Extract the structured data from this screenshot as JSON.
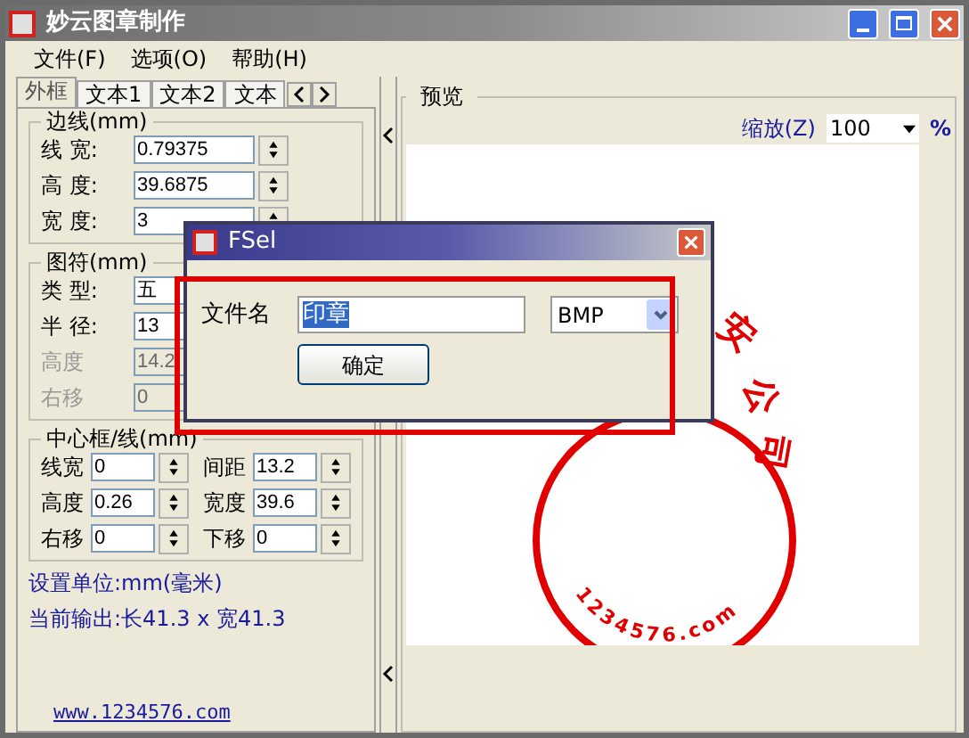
{
  "window": {
    "title": "妙云图章制作"
  },
  "menu": [
    {
      "label": "文件(F)"
    },
    {
      "label": "选项(O)"
    },
    {
      "label": "帮助(H)"
    }
  ],
  "tabs": [
    {
      "label": "外框",
      "selected": true
    },
    {
      "label": "文本1",
      "selected": false
    },
    {
      "label": "文本2",
      "selected": false
    },
    {
      "label": "文本",
      "selected": false
    }
  ],
  "groups": [
    {
      "title": "边线(mm)",
      "kind": "list",
      "fields": [
        {
          "label": "线 宽:",
          "value": "0.79375",
          "disabled": false
        },
        {
          "label": "高 度:",
          "value": "39.6875",
          "disabled": false
        },
        {
          "label": "宽 度:",
          "value": "3",
          "disabled": false
        }
      ]
    },
    {
      "title": "图符(mm)",
      "kind": "list",
      "fields": [
        {
          "label": "类 型:",
          "value": "五",
          "disabled": false
        },
        {
          "label": "半 径:",
          "value": "13",
          "disabled": false
        },
        {
          "label": "高度",
          "value": "14.2",
          "disabled": true
        },
        {
          "label": "右移",
          "value": "0",
          "disabled": true
        }
      ]
    },
    {
      "title": "中心框/线(mm)",
      "kind": "grid",
      "fields": [
        {
          "label": "线宽",
          "value": "0",
          "disabled": false
        },
        {
          "label": "间距",
          "value": "13.2",
          "disabled": false
        },
        {
          "label": "高度",
          "value": "0.26",
          "disabled": false
        },
        {
          "label": "宽度",
          "value": "39.6",
          "disabled": false
        },
        {
          "label": "右移",
          "value": "0",
          "disabled": false
        },
        {
          "label": "下移",
          "value": "0",
          "disabled": false
        }
      ]
    }
  ],
  "info": [
    "设置单位:mm(毫米)",
    "当前输出:长41.3 x 宽41.3"
  ],
  "link": "www.1234576.com",
  "preview": {
    "title": "预览",
    "zoom_label": "缩放(Z)",
    "zoom_value": "100",
    "zoom_unit": "%",
    "stamp_chars": [
      "安",
      "公",
      "司"
    ],
    "stamp_arc_text": "1234576.com"
  },
  "dialog": {
    "title": "FSel",
    "label": "文件名",
    "filename": "印章",
    "format": "BMP",
    "ok": "确定"
  }
}
